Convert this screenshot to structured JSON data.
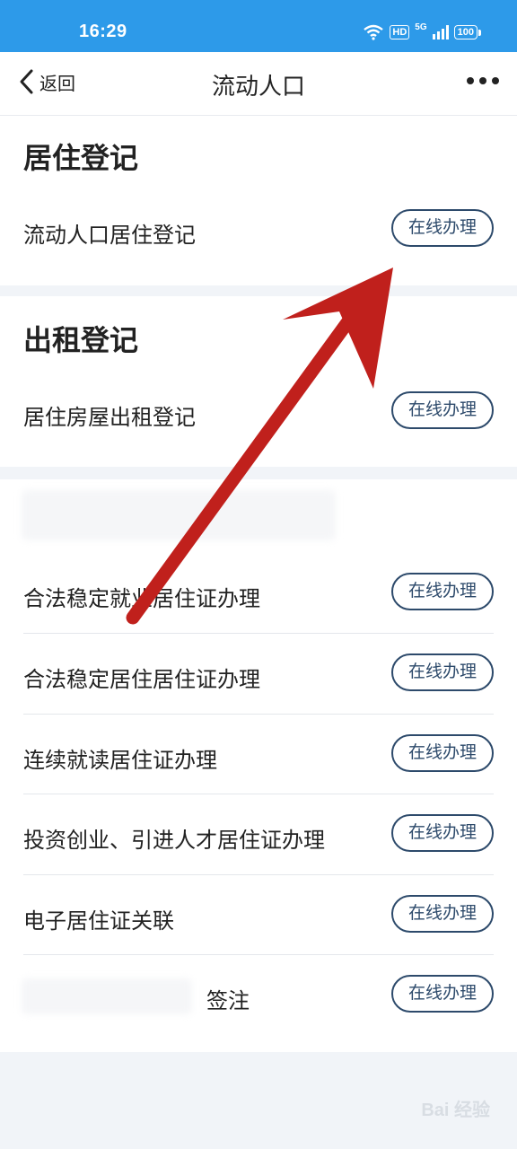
{
  "status": {
    "time": "16:29",
    "hd": "HD",
    "net": "5G",
    "battery": "100"
  },
  "nav": {
    "back_label": "返回",
    "title": "流动人口"
  },
  "section_residence": {
    "heading": "居住登记",
    "items": [
      {
        "label": "流动人口居住登记",
        "button": "在线办理"
      }
    ]
  },
  "section_rental": {
    "heading": "出租登记",
    "items": [
      {
        "label": "居住房屋出租登记",
        "button": "在线办理"
      }
    ]
  },
  "section_permit": {
    "items": [
      {
        "label": "合法稳定就业居住证办理",
        "button": "在线办理"
      },
      {
        "label": "合法稳定居住居住证办理",
        "button": "在线办理"
      },
      {
        "label": "连续就读居住证办理",
        "button": "在线办理"
      },
      {
        "label": "投资创业、引进人才居住证办理",
        "button": "在线办理"
      },
      {
        "label": "电子居住证关联",
        "button": "在线办理"
      },
      {
        "label": "签注",
        "button": "在线办理"
      }
    ]
  },
  "watermark": "Bai 经验",
  "colors": {
    "status_bar": "#2d9ae9",
    "button_border": "#2d4a6b",
    "arrow": "#c0201c"
  }
}
